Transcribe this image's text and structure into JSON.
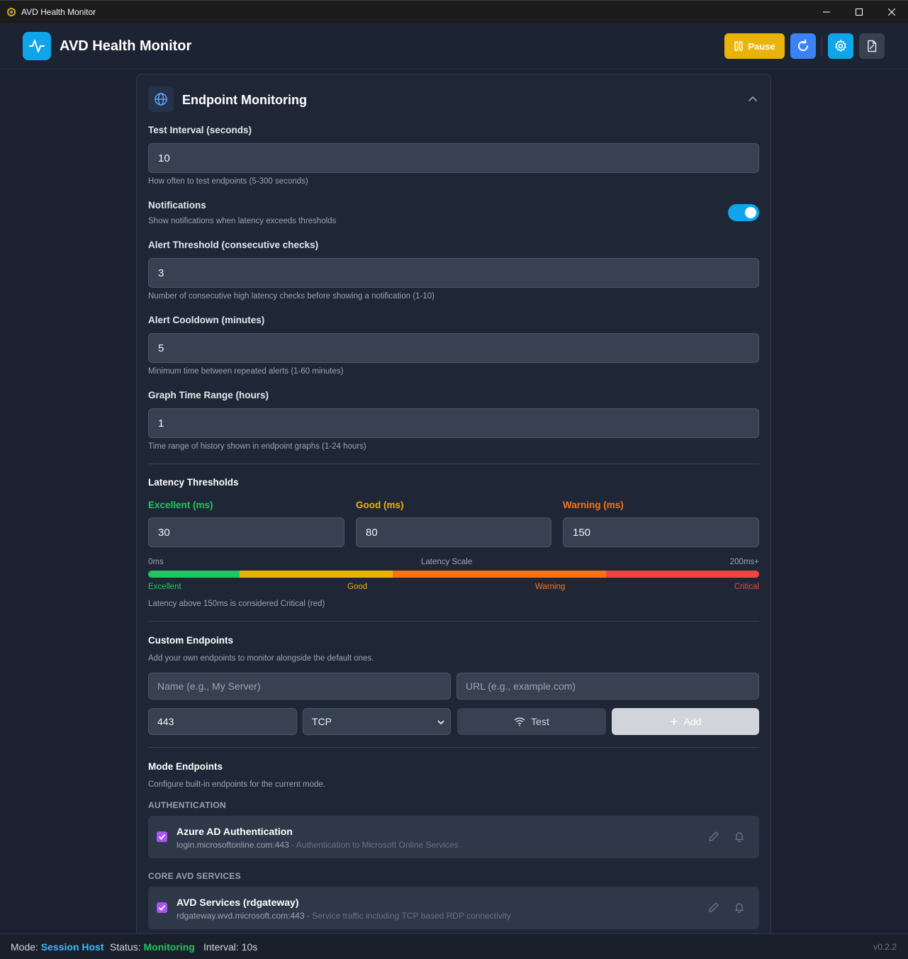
{
  "window": {
    "title": "AVD Health Monitor"
  },
  "header": {
    "app_title": "AVD Health Monitor",
    "pause_label": "Pause"
  },
  "panel": {
    "title": "Endpoint Monitoring",
    "test_interval": {
      "label": "Test Interval (seconds)",
      "value": "10",
      "hint": "How often to test endpoints (5-300 seconds)"
    },
    "notifications": {
      "label": "Notifications",
      "hint": "Show notifications when latency exceeds thresholds",
      "enabled": true
    },
    "alert_threshold": {
      "label": "Alert Threshold (consecutive checks)",
      "value": "3",
      "hint": "Number of consecutive high latency checks before showing a notification (1-10)"
    },
    "alert_cooldown": {
      "label": "Alert Cooldown (minutes)",
      "value": "5",
      "hint": "Minimum time between repeated alerts (1-60 minutes)"
    },
    "graph_range": {
      "label": "Graph Time Range (hours)",
      "value": "1",
      "hint": "Time range of history shown in endpoint graphs (1-24 hours)"
    }
  },
  "latency": {
    "title": "Latency Thresholds",
    "excellent": {
      "label": "Excellent (ms)",
      "value": "30"
    },
    "good": {
      "label": "Good (ms)",
      "value": "80"
    },
    "warning": {
      "label": "Warning (ms)",
      "value": "150"
    },
    "scale": {
      "min": "0ms",
      "title": "Latency Scale",
      "max": "200ms+",
      "labels": {
        "excellent": "Excellent",
        "good": "Good",
        "warning": "Warning",
        "critical": "Critical"
      }
    },
    "note": "Latency above 150ms is considered Critical (red)",
    "colors": {
      "excellent": "#22c55e",
      "good": "#eab308",
      "warning": "#f97316",
      "critical": "#ef4444"
    }
  },
  "custom": {
    "title": "Custom Endpoints",
    "subtitle": "Add your own endpoints to monitor alongside the default ones.",
    "name_placeholder": "Name (e.g., My Server)",
    "url_placeholder": "URL (e.g., example.com)",
    "port_value": "443",
    "protocol_value": "TCP",
    "test_label": "Test",
    "add_label": "Add"
  },
  "mode_endpoints": {
    "title": "Mode Endpoints",
    "subtitle": "Configure built-in endpoints for the current mode.",
    "categories": [
      {
        "name": "AUTHENTICATION",
        "items": [
          {
            "name": "Azure AD Authentication",
            "url": "login.microsoftonline.com:443",
            "desc": "- Authentication to Microsoft Online Services",
            "checked": true
          }
        ]
      },
      {
        "name": "CORE AVD SERVICES",
        "items": [
          {
            "name": "AVD Services (rdgateway)",
            "url": "rdgateway.wvd.microsoft.com:443",
            "desc": "- Service traffic including TCP based RDP connectivity",
            "checked": true
          }
        ]
      }
    ]
  },
  "status": {
    "mode_label": "Mode:",
    "mode_value": "Session Host",
    "status_label": "Status:",
    "status_value": "Monitoring",
    "interval": "Interval: 10s",
    "version": "v0.2.2"
  }
}
